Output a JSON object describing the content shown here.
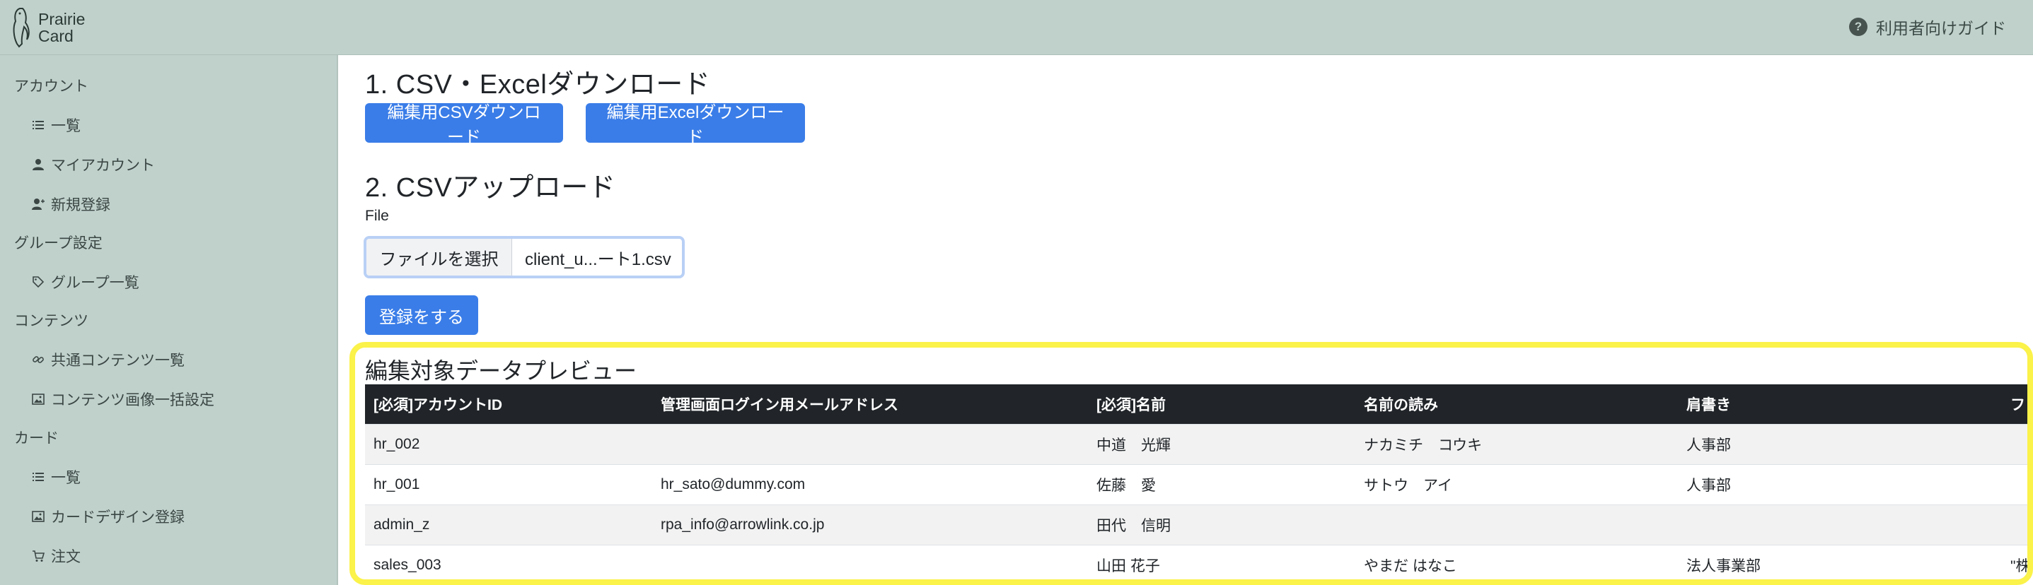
{
  "brand": {
    "line1": "Prairie",
    "line2": "Card"
  },
  "header": {
    "guide_label": "利用者向けガイド",
    "guide_icon": "help-circle-icon"
  },
  "sidebar": {
    "sections": [
      {
        "label": "アカウント"
      },
      {
        "label": "グループ設定"
      },
      {
        "label": "コンテンツ"
      },
      {
        "label": "カード"
      }
    ],
    "items": [
      {
        "label": "一覧",
        "icon": "list-icon"
      },
      {
        "label": "マイアカウント",
        "icon": "person-icon"
      },
      {
        "label": "新規登録",
        "icon": "person-add-icon"
      },
      {
        "label": "グループ一覧",
        "icon": "tag-icon"
      },
      {
        "label": "共通コンテンツ一覧",
        "icon": "link-icon"
      },
      {
        "label": "コンテンツ画像一括設定",
        "icon": "image-icon"
      },
      {
        "label": "一覧",
        "icon": "list-icon"
      },
      {
        "label": "カードデザイン登録",
        "icon": "image-icon"
      },
      {
        "label": "注文",
        "icon": "cart-icon"
      }
    ]
  },
  "main": {
    "section1_title": "1. CSV・Excelダウンロード",
    "csv_download_label": "編集用CSVダウンロード",
    "excel_download_label": "編集用Excelダウンロード",
    "section2_title": "2. CSVアップロード",
    "file_label": "File",
    "file_choose_label": "ファイルを選択",
    "file_name": "client_u...ート1.csv",
    "register_label": "登録をする"
  },
  "preview": {
    "title": "編集対象データプレビュー",
    "columns": [
      "[必須]アカウントID",
      "管理画面ログイン用メールアドレス",
      "[必須]名前",
      "名前の読み",
      "肩書き",
      "フ"
    ],
    "rows": [
      [
        "hr_002",
        "",
        "中道　光輝",
        "ナカミチ　コウキ",
        "人事部",
        ""
      ],
      [
        "hr_001",
        "hr_sato@dummy.com",
        "佐藤　愛",
        "サトウ　アイ",
        "人事部",
        ""
      ],
      [
        "admin_z",
        "rpa_info@arrowlink.co.jp",
        "田代　信明",
        "",
        "",
        ""
      ],
      [
        "sales_003",
        "",
        "山田 花子",
        "やまだ はなこ",
        "法人事業部",
        "\"株"
      ]
    ]
  },
  "colors": {
    "header_bg": "#c0d1cc",
    "primary": "#3a7de8",
    "highlight": "#fbf24a",
    "table_head": "#212529"
  }
}
